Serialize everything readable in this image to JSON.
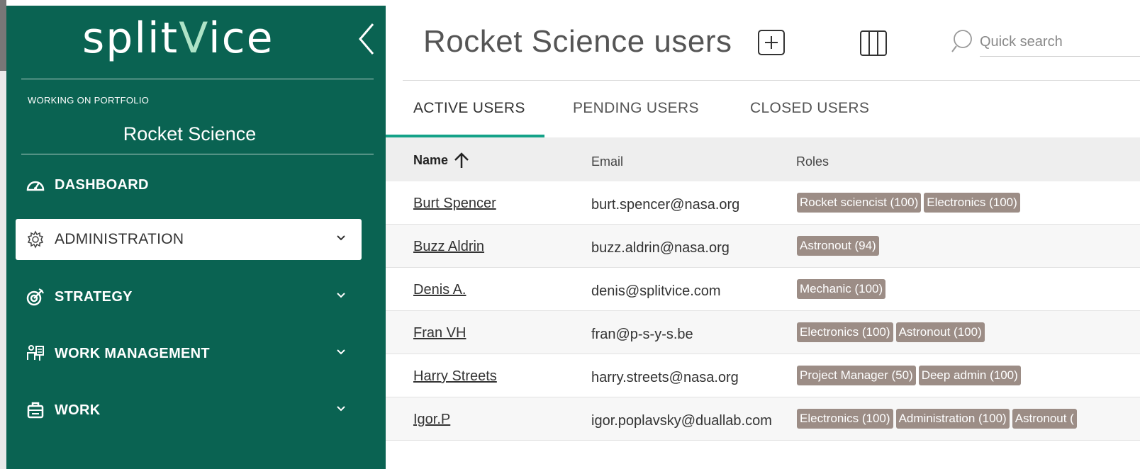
{
  "sidebar": {
    "logo": {
      "part1": "split",
      "part2": "V",
      "part3": "ice"
    },
    "portfolio_label": "WORKING ON PORTFOLIO",
    "portfolio_name": "Rocket Science",
    "items": [
      {
        "label": "DASHBOARD",
        "icon": "dashboard-gauge-icon"
      },
      {
        "label": "ADMINISTRATION",
        "icon": "gear-icon",
        "active": true
      },
      {
        "label": "STRATEGY",
        "icon": "target-icon"
      },
      {
        "label": "WORK MANAGEMENT",
        "icon": "work-management-icon"
      },
      {
        "label": "WORK",
        "icon": "briefcase-icon"
      }
    ],
    "colors": {
      "background": "#0a6352",
      "logo_accent": "#aee3c7"
    }
  },
  "header": {
    "title": "Rocket Science users",
    "search_placeholder": "Quick search"
  },
  "tabs": [
    {
      "label": "ACTIVE USERS",
      "active": true
    },
    {
      "label": "PENDING USERS"
    },
    {
      "label": "CLOSED USERS"
    }
  ],
  "table": {
    "columns": {
      "name": "Name",
      "email": "Email",
      "roles": "Roles"
    },
    "sort": {
      "column": "Name",
      "direction": "ascending"
    },
    "rows": [
      {
        "name": "Burt Spencer",
        "email": "burt.spencer@nasa.org",
        "roles": [
          "Rocket sciencist (100)",
          "Electronics (100)"
        ]
      },
      {
        "name": "Buzz Aldrin",
        "email": "buzz.aldrin@nasa.org",
        "roles": [
          "Astronout (94)"
        ]
      },
      {
        "name": "Denis A.",
        "email": "denis@splitvice.com",
        "roles": [
          "Mechanic (100)"
        ]
      },
      {
        "name": "Fran VH",
        "email": "fran@p-s-y-s.be",
        "roles": [
          "Electronics (100)",
          "Astronout (100)"
        ]
      },
      {
        "name": "Harry Streets",
        "email": "harry.streets@nasa.org",
        "roles": [
          "Project Manager (50)",
          "Deep admin (100)"
        ]
      },
      {
        "name": "Igor.P",
        "email": "igor.poplavsky@duallab.com",
        "roles": [
          "Electronics (100)",
          "Administration (100)",
          "Astronout ("
        ]
      }
    ],
    "colors": {
      "role_badge": "#9c8d86",
      "active_tab_underline": "#14a288"
    }
  }
}
